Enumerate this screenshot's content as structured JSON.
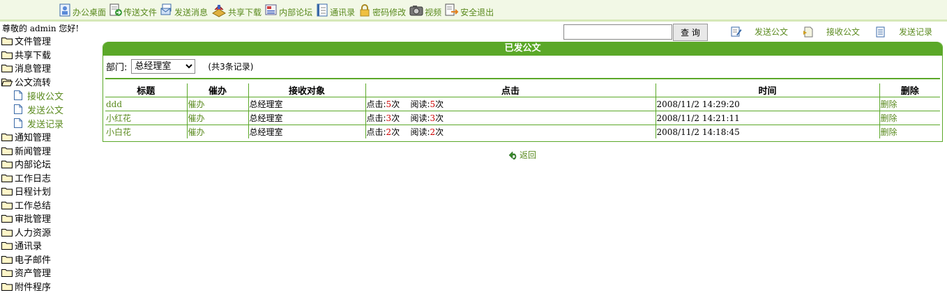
{
  "topnav": [
    {
      "label": "办公桌面",
      "icon": "desktop-icon"
    },
    {
      "label": "传送文件",
      "icon": "file-transfer-icon"
    },
    {
      "label": "发送消息",
      "icon": "message-icon"
    },
    {
      "label": "共享下载",
      "icon": "download-icon"
    },
    {
      "label": "内部论坛",
      "icon": "forum-icon"
    },
    {
      "label": "通讯录",
      "icon": "address-book-icon"
    },
    {
      "label": "密码修改",
      "icon": "lock-icon"
    },
    {
      "label": "视频",
      "icon": "camera-icon"
    },
    {
      "label": "安全退出",
      "icon": "logout-icon"
    }
  ],
  "greeting": "尊敬的 admin 您好!",
  "sidebar": {
    "items": [
      {
        "label": "文件管理"
      },
      {
        "label": "共享下载"
      },
      {
        "label": "消息管理"
      },
      {
        "label": "公文流转",
        "open": true,
        "children": [
          {
            "label": "接收公文"
          },
          {
            "label": "发送公文"
          },
          {
            "label": "发送记录"
          }
        ]
      },
      {
        "label": "通知管理"
      },
      {
        "label": "新闻管理"
      },
      {
        "label": "内部论坛"
      },
      {
        "label": "工作日志"
      },
      {
        "label": "日程计划"
      },
      {
        "label": "工作总结"
      },
      {
        "label": "审批管理"
      },
      {
        "label": "人力资源"
      },
      {
        "label": "通讯录"
      },
      {
        "label": "电子邮件"
      },
      {
        "label": "资产管理"
      },
      {
        "label": "附件程序"
      }
    ]
  },
  "search": {
    "value": "",
    "button": "查 询"
  },
  "actions": {
    "send": "发送公文",
    "receive": "接收公文",
    "record": "发送记录"
  },
  "panel": {
    "title": "已发公文",
    "dept_label": "部门:",
    "dept_selected": "总经理室",
    "count_text": "(共3条记录)"
  },
  "table": {
    "headers": {
      "title": "标题",
      "urge": "催办",
      "receiver": "接收对象",
      "clicks": "点击",
      "time": "时间",
      "delete": "删除"
    },
    "rows": [
      {
        "title": "ddd",
        "urge": "催办",
        "receiver": "总经理室",
        "click_label": "点击:",
        "clicks": "5",
        "times_unit": "次",
        "read_label": "阅读:",
        "reads": "5",
        "time": "2008/11/2 14:29:20",
        "delete": "删除"
      },
      {
        "title": "小红花",
        "urge": "催办",
        "receiver": "总经理室",
        "click_label": "点击:",
        "clicks": "3",
        "times_unit": "次",
        "read_label": "阅读:",
        "reads": "3",
        "time": "2008/11/2 14:21:11",
        "delete": "删除"
      },
      {
        "title": "小白花",
        "urge": "催办",
        "receiver": "总经理室",
        "click_label": "点击:",
        "clicks": "2",
        "times_unit": "次",
        "read_label": "阅读:",
        "reads": "2",
        "time": "2008/11/2 14:18:45",
        "delete": "删除"
      }
    ]
  },
  "back": "返回",
  "colors": {
    "accent": "#5ba828",
    "link": "#5a8a1e",
    "topbar_bg": "#f2f8e6",
    "highlight": "#cc0000"
  }
}
